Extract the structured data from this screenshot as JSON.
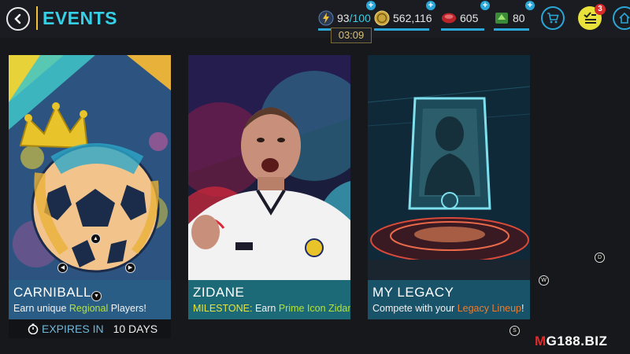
{
  "header": {
    "title": "EVENTS",
    "back_icon": "chevron-left-icon"
  },
  "currencies": {
    "energy": {
      "current": "93",
      "max": "/100",
      "timer": "03:09",
      "icon": "lightning-icon"
    },
    "coins": {
      "value": "562,116",
      "icon": "coin-icon"
    },
    "points": {
      "value": "605",
      "icon": "ruby-icon"
    },
    "gems": {
      "value": "80",
      "icon": "gem-icon"
    }
  },
  "actions": {
    "store_icon": "cart-icon",
    "objectives_icon": "objectives-icon",
    "objectives_badge": "3",
    "home_icon": "home-icon"
  },
  "events": [
    {
      "name": "CARNIBALL",
      "subtitle_pre": "Earn unique ",
      "subtitle_hl": "Regional",
      "subtitle_post": " Players!",
      "expires_label": "EXPIRES IN",
      "expires_value": "10 DAYS"
    },
    {
      "name": "ZIDANE",
      "subtitle_label": "MILESTONE:",
      "subtitle_pre": " Earn ",
      "subtitle_hl": "Prime Icon Zidane",
      "subtitle_post": "!"
    },
    {
      "name": "MY LEGACY",
      "subtitle_pre": "Compete with your ",
      "subtitle_hl": "Legacy Lineup",
      "subtitle_post": "!"
    }
  ],
  "nav_hints": {
    "a": "D",
    "b": "W",
    "c": "S"
  },
  "watermark": {
    "pre": "M",
    "mid": "G188",
    "post": ".BIZ"
  },
  "colors": {
    "accent": "#35d0e6",
    "gold": "#f0c23a",
    "highlight_green": "#b6e33a",
    "highlight_orange": "#f07a2a"
  }
}
